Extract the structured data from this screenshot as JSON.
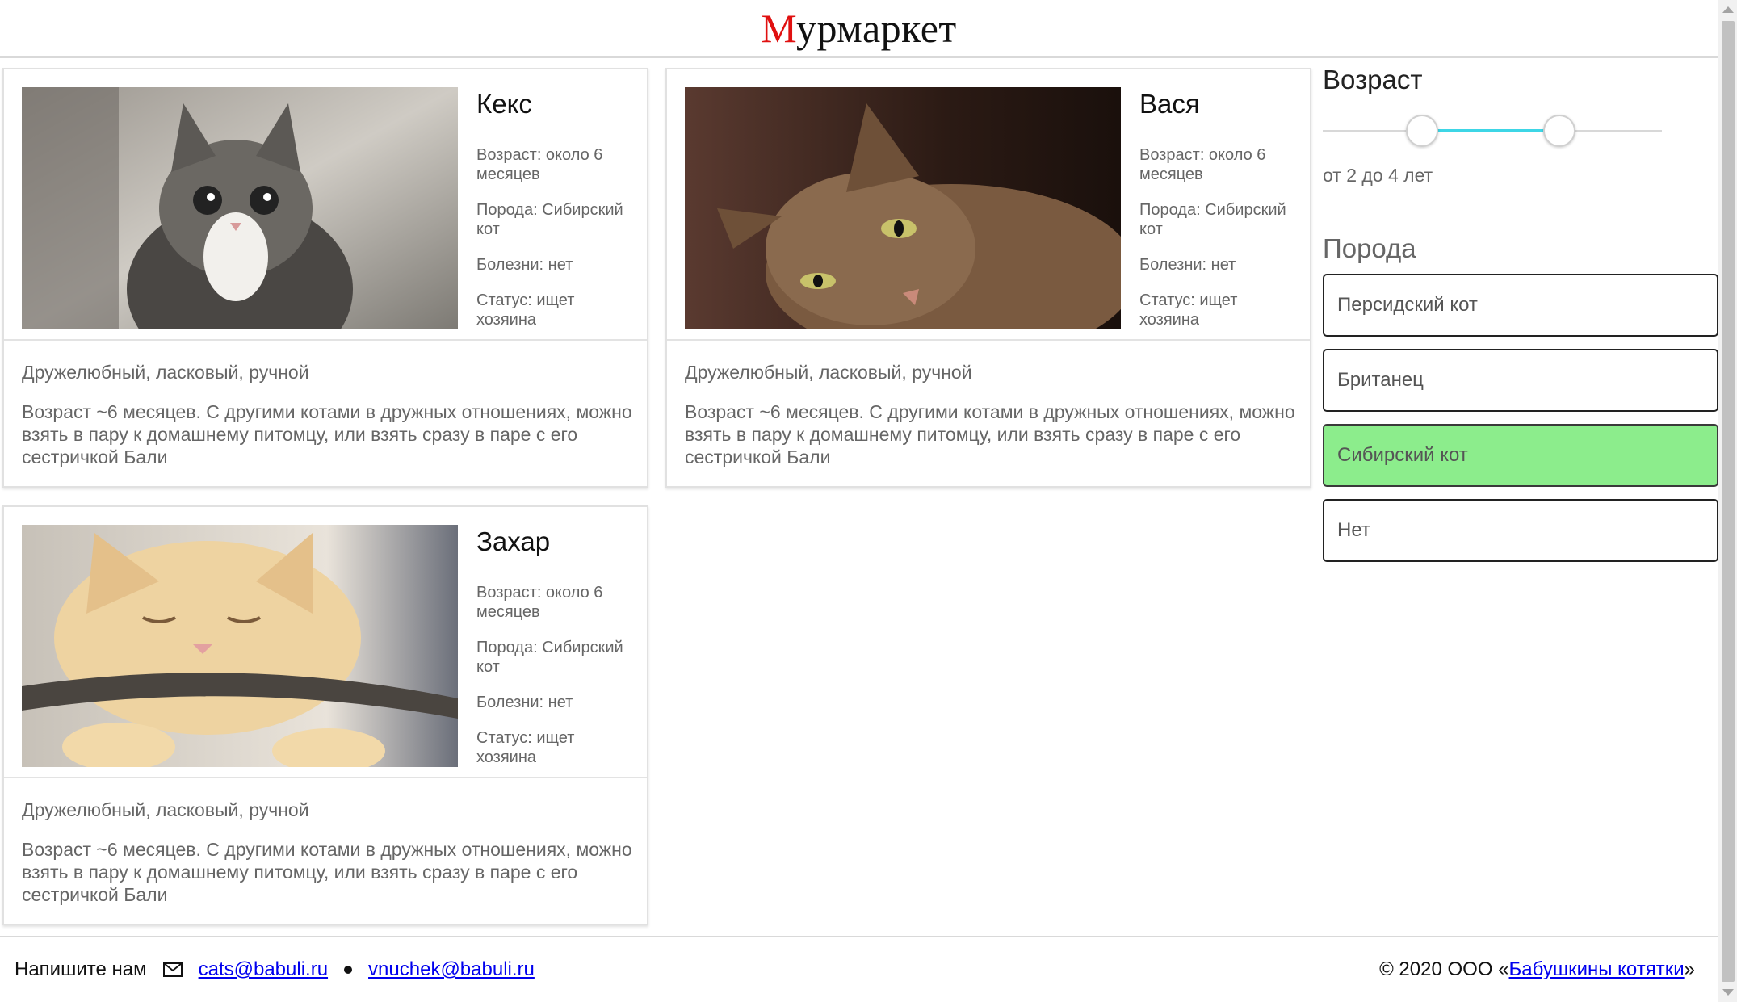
{
  "header": {
    "logo_first": "М",
    "logo_rest": "урмаркет"
  },
  "cards": [
    {
      "name": "Кекс",
      "age": "Возраст: около 6 месяцев",
      "breed": "Порода: Сибирский кот",
      "diseases": "Болезни: нет",
      "status": "Статус: ищет хозяина",
      "traits": "Дружелюбный, ласковый, ручной",
      "description": "Возраст ~6 месяцев. С другими котами в дружных отношениях, можно взять в пару к домашнему питомцу, или взять сразу в паре с его сестричкой Бали",
      "photo_colors": [
        "#8c8c86",
        "#cfcbc4",
        "#3a3835"
      ]
    },
    {
      "name": "Вася",
      "age": "Возраст: около 6 месяцев",
      "breed": "Порода: Сибирский кот",
      "diseases": "Болезни: нет",
      "status": "Статус: ищет хозяина",
      "traits": "Дружелюбный, ласковый, ручной",
      "description": "Возраст ~6 месяцев. С другими котами в дружных отношениях, можно взять в пару к домашнему питомцу, или взять сразу в паре с его сестричкой Бали",
      "photo_colors": [
        "#2b1a14",
        "#8a6a4e",
        "#5a4434"
      ]
    },
    {
      "name": "Захар",
      "age": "Возраст: около 6 месяцев",
      "breed": "Порода: Сибирский кот",
      "diseases": "Болезни: нет",
      "status": "Статус: ищет хозяина",
      "traits": "Дружелюбный, ласковый, ручной",
      "description": "Возраст ~6 месяцев. С другими котами в дружных отношениях, можно взять в пару к домашнему питомцу, или взять сразу в паре с его сестричкой Бали",
      "photo_colors": [
        "#d9c6a8",
        "#f2d9a9",
        "#4a4540"
      ]
    }
  ],
  "filters": {
    "age_title": "Возраст",
    "age_range_text": "от 2 до 4 лет",
    "age_min": 2,
    "age_max": 4,
    "breed_title": "Порода",
    "breeds": [
      "Персидский кот",
      "Британец",
      "Сибирский кот",
      "Нет"
    ],
    "selected_breed": "Сибирский кот",
    "selected_color": "#8ced8c"
  },
  "footer": {
    "contact_label": "Напишите нам",
    "email_1": "cats@babuli.ru",
    "email_2": "vnuchek@babuli.ru",
    "copyright_prefix": "© 2020 ООО «",
    "company": "Бабушкины котятки",
    "copyright_suffix": "»"
  }
}
